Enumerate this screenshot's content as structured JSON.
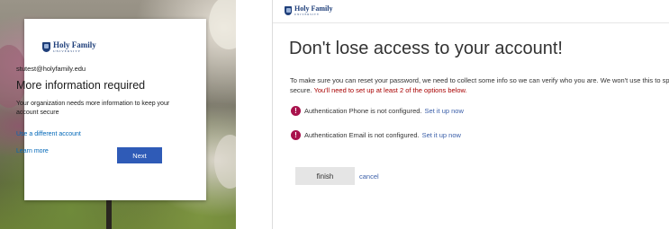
{
  "signin": {
    "logo_brand": "Holy Family",
    "logo_sub": "UNIVERSITY",
    "email": "stutest@holyfamily.edu",
    "title": "More information required",
    "description": "Your organization needs more information to keep your account secure",
    "use_different_account": "Use a different account",
    "learn_more": "Learn more",
    "next_label": "Next",
    "button_color": "#2f5bb7",
    "link_color": "#0067b8"
  },
  "setup": {
    "logo_brand": "Holy Family",
    "logo_sub": "UNIVERSITY",
    "title": "Don't lose access to your account!",
    "info_text": "To make sure you can reset your password, we need to collect some info so we can verify who you are. We won't use this to spam you - just to keep your account more",
    "info_secure": "secure.",
    "info_warning": "You'll need to set up at least 2 of the options below.",
    "methods": [
      {
        "label": "Authentication Phone is not configured.",
        "link": "Set it up now",
        "icon": "alert-icon"
      },
      {
        "label": "Authentication Email is not configured.",
        "link": "Set it up now",
        "icon": "alert-icon"
      }
    ],
    "finish_label": "finish",
    "cancel_label": "cancel",
    "warning_color": "#a80000",
    "alert_icon_color": "#a8124c"
  }
}
